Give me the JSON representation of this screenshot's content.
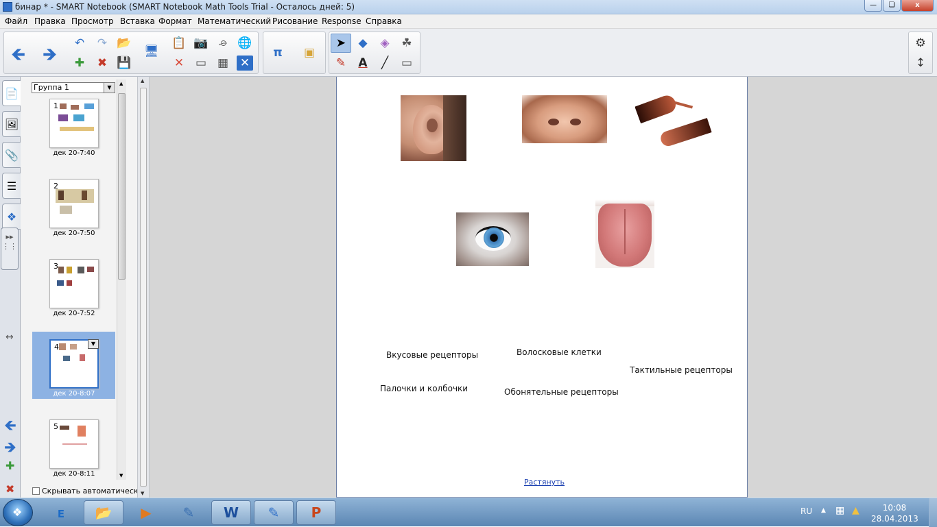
{
  "window": {
    "title": "бинар * - SMART Notebook (SMART Notebook Math Tools Trial - Осталось дней: 5)",
    "minimize_icon": "minimize-icon",
    "maximize_icon": "maximize-icon",
    "close_glyph": "x"
  },
  "menu": {
    "items": [
      "Файл",
      "Правка",
      "Просмотр",
      "Вставка",
      "Формат",
      "Математический",
      "Рисование",
      "Response",
      "Справка"
    ]
  },
  "toolbar": {
    "pi_label": "π",
    "text_tool_label": "A"
  },
  "sorter": {
    "group_name": "Группа 1",
    "pages": [
      {
        "number": "1",
        "label": "дек 20-7:40"
      },
      {
        "number": "2",
        "label": "дек 20-7:50"
      },
      {
        "number": "3",
        "label": "дек 20-7:52"
      },
      {
        "number": "4",
        "label": "дек 20-8:07"
      },
      {
        "number": "5",
        "label": "дек 20-8:11"
      }
    ],
    "selected_page": 4,
    "autohide_label": "Скрывать автоматическ"
  },
  "page": {
    "images": [
      "ear-photo",
      "nose-photo",
      "hands-photo",
      "eye-photo",
      "tongue-photo"
    ],
    "labels": {
      "taste": "Вкусовые рецепторы",
      "hair_cells": "Волосковые клетки",
      "tactile": "Тактильные рецепторы",
      "rods_cones": "Палочки и колбочки",
      "olfactory": "Обонятельные рецепторы"
    },
    "stretch_link": "Растянуть"
  },
  "taskbar": {
    "apps": [
      "explorer",
      "internet-explorer",
      "media-player",
      "paint",
      "word",
      "smart-notebook",
      "powerpoint"
    ],
    "word_label": "W",
    "powerpoint_label": "P",
    "lang": "RU",
    "time": "10:08",
    "date": "28.04.2013"
  }
}
